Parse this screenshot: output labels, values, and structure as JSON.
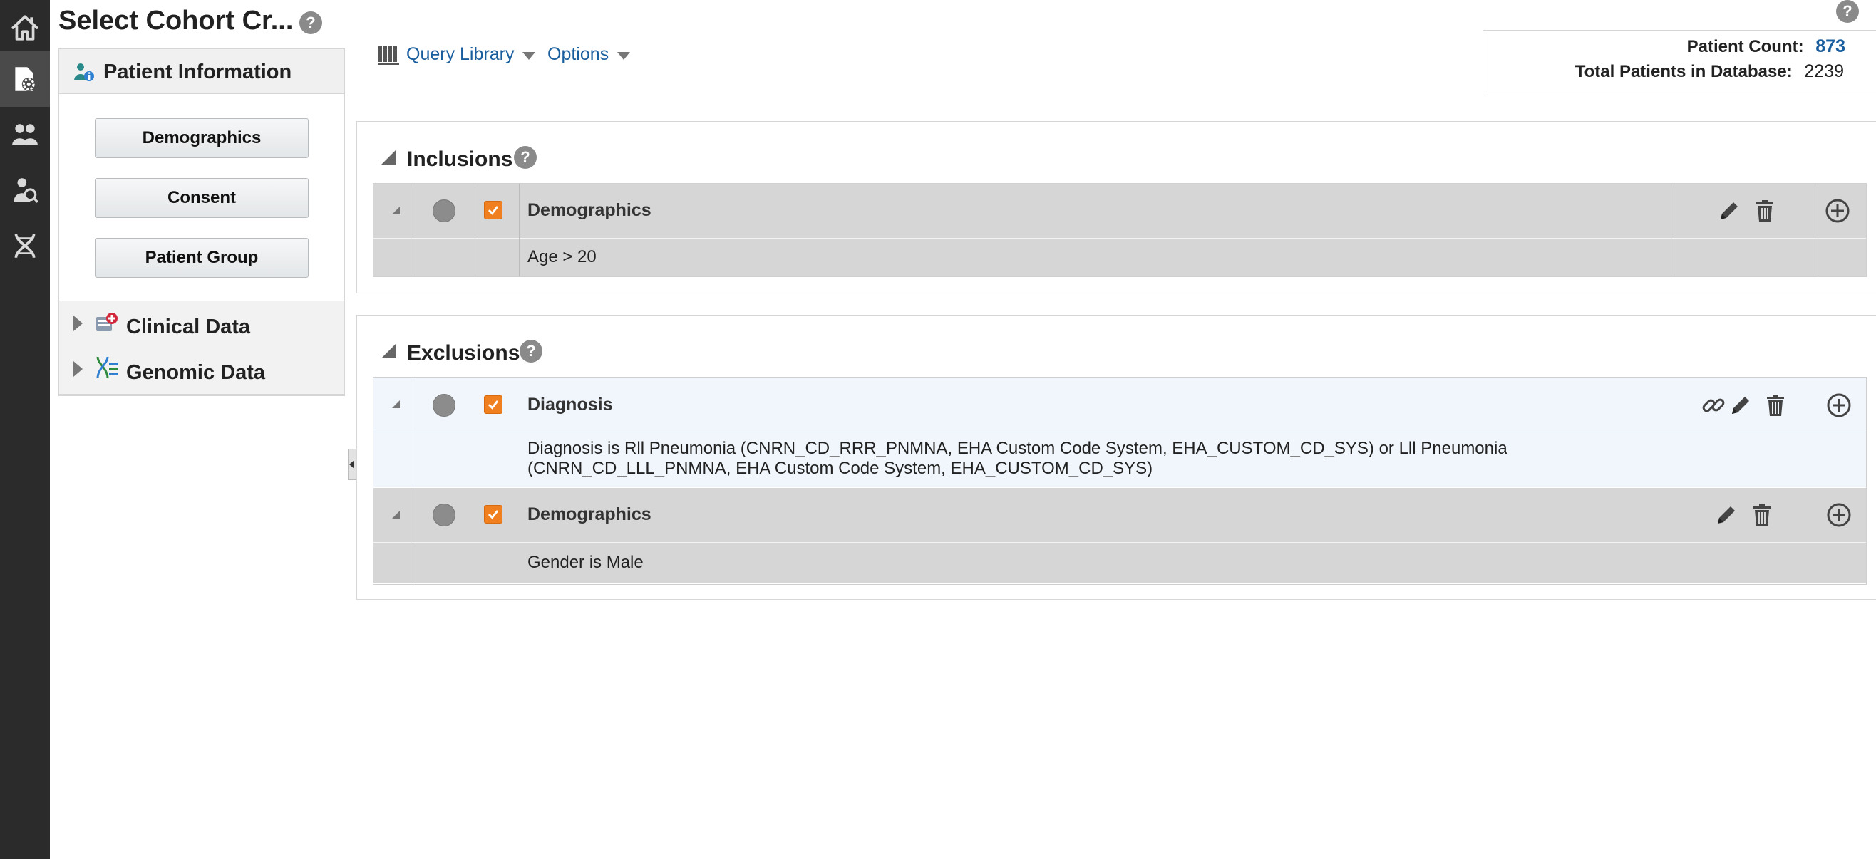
{
  "app": {
    "page_title": "Select Cohort Cr...",
    "help_glyph": "?"
  },
  "nav_rail": [
    "home-icon",
    "cohort-settings-icon",
    "patients-icon",
    "researcher-icon",
    "dna-icon"
  ],
  "left_panel": {
    "patient_information": {
      "label": "Patient Information",
      "buttons": [
        "Demographics",
        "Consent",
        "Patient Group"
      ]
    },
    "clinical_data": {
      "label": "Clinical Data"
    },
    "genomic_data": {
      "label": "Genomic Data"
    }
  },
  "toolbar": {
    "query_library": "Query Library",
    "options": "Options"
  },
  "counts": {
    "patient_count_label": "Patient Count:",
    "patient_count_value": "873",
    "total_label": "Total Patients in Database:",
    "total_value": "2239"
  },
  "inclusions": {
    "title": "Inclusions",
    "criteria": [
      {
        "name": "Demographics",
        "detail": "Age > 20",
        "checked": true
      }
    ]
  },
  "exclusions": {
    "title": "Exclusions",
    "criteria": [
      {
        "name": "Diagnosis",
        "detail_line1": "Diagnosis is Rll Pneumonia (CNRN_CD_RRR_PNMNA, EHA Custom Code System, EHA_CUSTOM_CD_SYS) or Lll Pneumonia",
        "detail_line2": "(CNRN_CD_LLL_PNMNA, EHA Custom Code System, EHA_CUSTOM_CD_SYS)",
        "checked": true
      },
      {
        "name": "Demographics",
        "detail": "Gender is Male",
        "checked": true
      }
    ]
  },
  "colors": {
    "accent_link": "#1a5e9e",
    "checkbox": "#f07f1f",
    "rail": "#2b2b2b"
  }
}
